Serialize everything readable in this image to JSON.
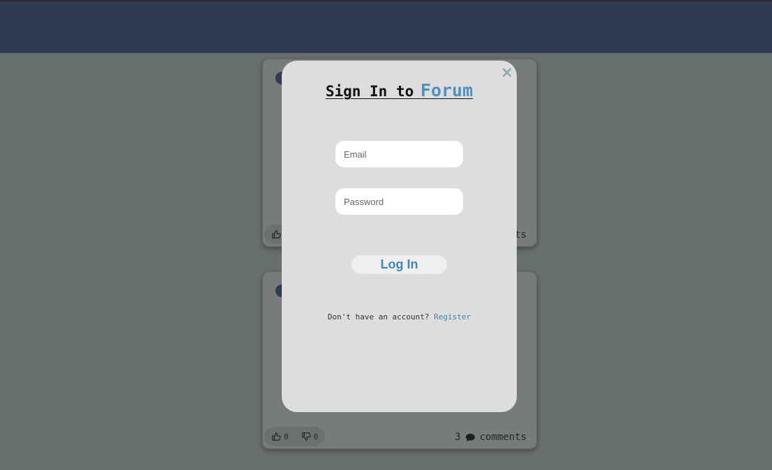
{
  "post_cards": [
    {
      "likes": "",
      "dislikes": "",
      "comment_count": "",
      "comments_label": "ts"
    },
    {
      "likes": "0",
      "dislikes": "0",
      "comment_count": "3",
      "comments_label": "comments"
    }
  ],
  "modal": {
    "close_symbol": "×",
    "title_prefix": "Sign In to",
    "title_brand": "Forum",
    "email_placeholder": "Email",
    "password_placeholder": "Password",
    "login_label": "Log In",
    "register_prompt": "Don't have an account?",
    "register_link": "Register"
  },
  "icons": {
    "avatar": "user-avatar-icon",
    "like": "thumbs-up-icon",
    "dislike": "thumbs-down-icon",
    "comment": "comment-bubble-icon",
    "close": "close-icon"
  },
  "colors": {
    "header": "#3c4f87",
    "brand": "#4f93bd",
    "link": "#3f88b8",
    "modal_bg": "#dddddd"
  }
}
